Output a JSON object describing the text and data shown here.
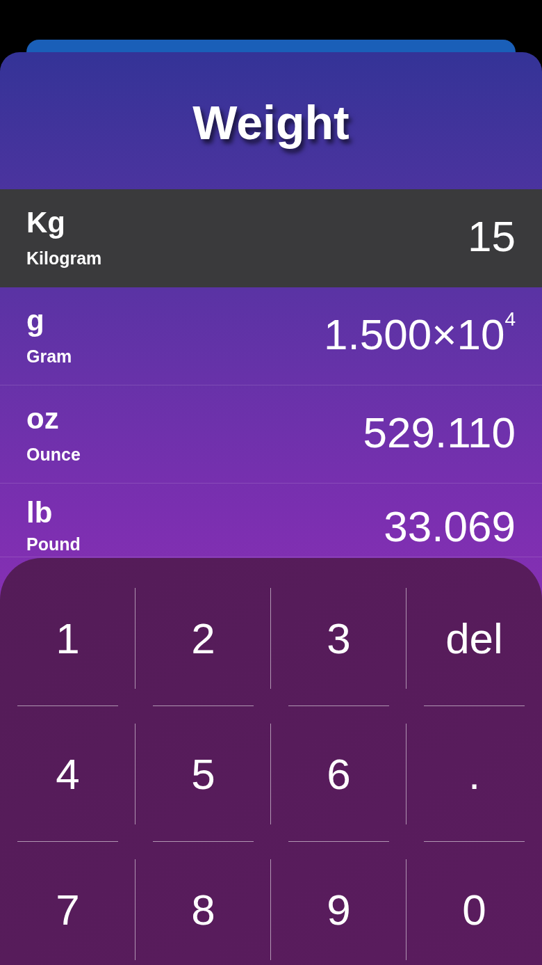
{
  "title": "Weight",
  "units": [
    {
      "symbol": "Kg",
      "name": "Kilogram",
      "value": "15",
      "selected": true
    },
    {
      "symbol": "g",
      "name": "Gram",
      "value": "1.500×10$^{4}$",
      "selected": false
    },
    {
      "symbol": "oz",
      "name": "Ounce",
      "value": "529.110",
      "selected": false
    },
    {
      "symbol": "lb",
      "name": "Pound",
      "value": "33.069",
      "selected": false
    }
  ],
  "keys": [
    "1",
    "2",
    "3",
    "del",
    "4",
    "5",
    "6",
    ".",
    "7",
    "8",
    "9",
    "0"
  ]
}
